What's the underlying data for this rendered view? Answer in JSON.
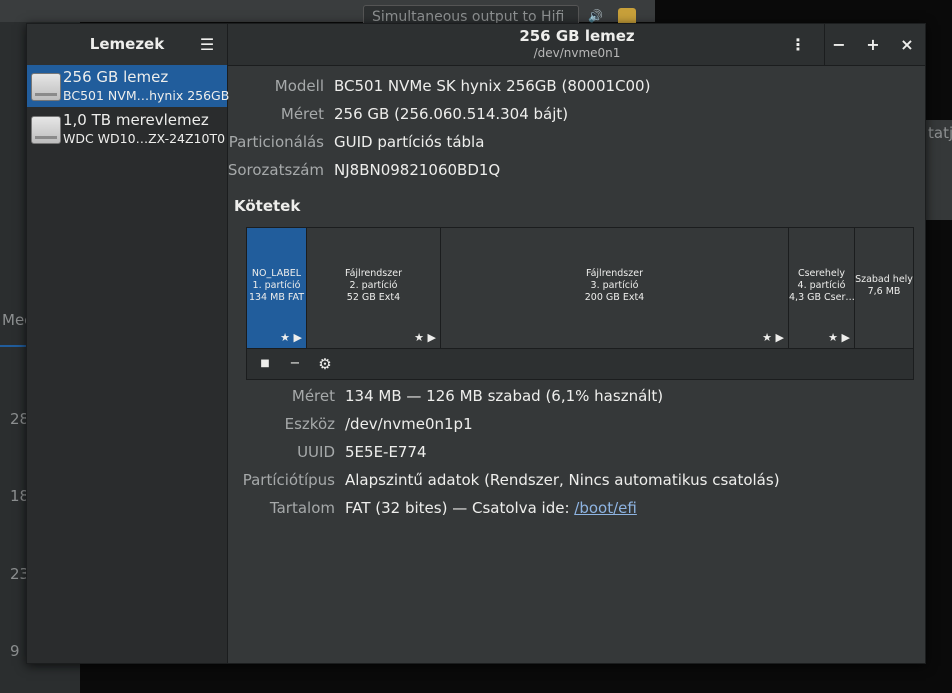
{
  "background": {
    "output_field": "Simultaneous output to Hifi",
    "right_partial": "tatj",
    "left_partial": "Mec",
    "numbers": [
      "28",
      "18",
      "23",
      "9"
    ]
  },
  "sidebar": {
    "title": "Lemezek",
    "menu_icon": "hamburger-icon",
    "drives": [
      {
        "name": "256 GB lemez",
        "model": "BC501 NVM…hynix 256GB",
        "selected": true
      },
      {
        "name": "1,0 TB merevlemez",
        "model": "WDC WD10…ZX-24Z10T0",
        "selected": false
      }
    ]
  },
  "header": {
    "title": "256 GB lemez",
    "subtitle": "/dev/nvme0n1",
    "menu_icon": "kebab-icon",
    "minimize": "−",
    "maximize": "+",
    "close": "×"
  },
  "drive_info": [
    {
      "label": "Modell",
      "value": "BC501 NVMe SK hynix 256GB (80001C00)"
    },
    {
      "label": "Méret",
      "value": "256 GB (256.060.514.304 bájt)"
    },
    {
      "label": "Particionálás",
      "value": "GUID partíciós tábla"
    },
    {
      "label": "Sorozatszám",
      "value": "NJ8BN09821060BD1Q"
    }
  ],
  "volumes_title": "Kötetek",
  "volumes": [
    {
      "lines": [
        "NO_LABEL",
        "1. partíció",
        "134 MB FAT"
      ],
      "selected": true,
      "icons": "★ ▶"
    },
    {
      "lines": [
        "Fájlrendszer",
        "2. partíció",
        "52 GB Ext4"
      ],
      "selected": false,
      "icons": "★ ▶"
    },
    {
      "lines": [
        "Fájlrendszer",
        "3. partíció",
        "200 GB Ext4"
      ],
      "selected": false,
      "icons": "★ ▶"
    },
    {
      "lines": [
        "Cserehely",
        "4. partíció",
        "4,3 GB Cser…"
      ],
      "selected": false,
      "icons": "★ ▶"
    },
    {
      "lines": [
        "Szabad hely",
        "7,6 MB"
      ],
      "selected": false,
      "icons": ""
    }
  ],
  "volume_tools": {
    "stop": "■",
    "remove": "−",
    "settings_icon": "gears-icon"
  },
  "partition_info": [
    {
      "label": "Méret",
      "value": "134 MB — 126 MB szabad (6,1% használt)"
    },
    {
      "label": "Eszköz",
      "value": "/dev/nvme0n1p1"
    },
    {
      "label": "UUID",
      "value": "5E5E-E774"
    },
    {
      "label": "Partíciótípus",
      "value": "Alapszintű adatok (Rendszer, Nincs automatikus csatolás)"
    },
    {
      "label": "Tartalom",
      "value": "FAT (32 bites) — Csatolva ide:",
      "link": "/boot/efi"
    }
  ]
}
